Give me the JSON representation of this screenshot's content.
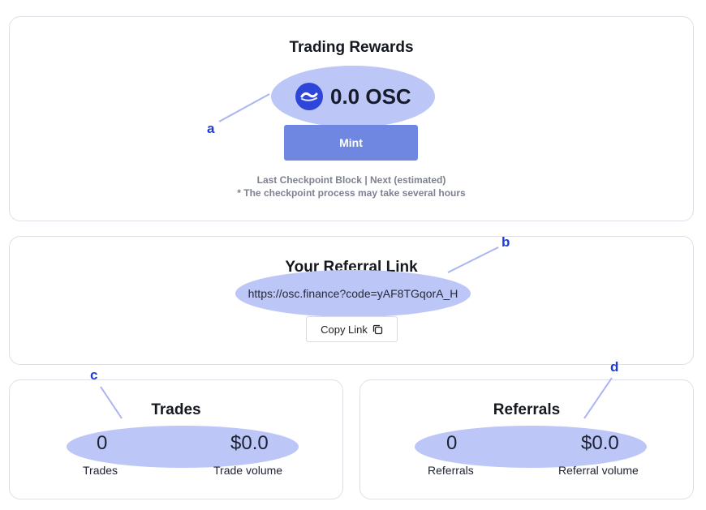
{
  "annotations": [
    "a",
    "b",
    "c",
    "d"
  ],
  "rewards": {
    "title": "Trading Rewards",
    "amount": "0.0 OSC",
    "token_icon": "osc-token-icon",
    "mint_label": "Mint",
    "checkpoint_line": "Last Checkpoint Block | Next (estimated)",
    "checkpoint_note": "* The checkpoint process may take several hours"
  },
  "referral": {
    "title": "Your Referral Link",
    "link": "https://osc.finance?code=yAF8TGqorA_H",
    "copy_label": "Copy Link",
    "copy_icon": "copy-icon"
  },
  "trades": {
    "title": "Trades",
    "count_value": "0",
    "count_label": "Trades",
    "volume_value": "$0.0",
    "volume_label": "Trade volume"
  },
  "referrals": {
    "title": "Referrals",
    "count_value": "0",
    "count_label": "Referrals",
    "volume_value": "$0.0",
    "volume_label": "Referral volume"
  },
  "colors": {
    "highlight": "#bcc6f7",
    "accent": "#2d45d9",
    "button": "#6f87e0",
    "annotation": "#1f3bd6"
  }
}
